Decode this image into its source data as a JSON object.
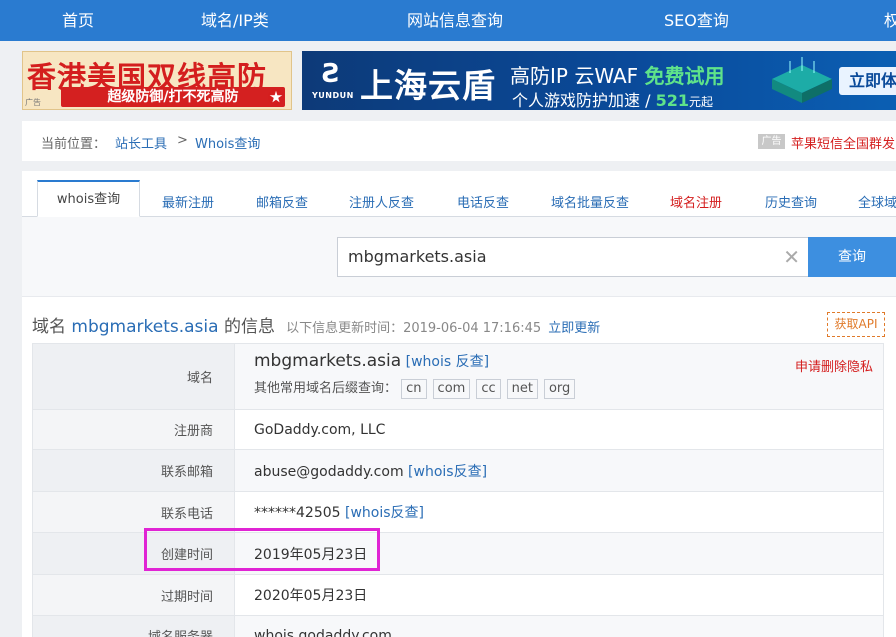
{
  "topnav": {
    "items": [
      "首页",
      "域名/IP类",
      "网站信息查询",
      "SEO查询",
      "权"
    ]
  },
  "ads": {
    "ad1": {
      "headline": "香港美国双线高防",
      "subline": "超级防御/打不死高防",
      "tag": "广告"
    },
    "ad2": {
      "brand": "YUNDUN",
      "big": "上海云盾",
      "line1_a": "高防IP 云WAF ",
      "line1_b": "免费试用",
      "line2_a": "个人游戏防护加速 / ",
      "line2_b": "521",
      "line2_c": "元起",
      "cta": "立即体"
    }
  },
  "breadcrumb": {
    "label": "当前位置：",
    "link1": "站长工具",
    "sep": ">",
    "link2": "Whois查询",
    "ad_tag": "广告",
    "ad_text": "苹果短信全国群发"
  },
  "tabs": [
    "whois查询",
    "最新注册",
    "邮箱反查",
    "注册人反查",
    "电话反查",
    "域名批量反查",
    "域名注册",
    "历史查询",
    "全球域"
  ],
  "search": {
    "value": "mbgmarkets.asia",
    "clear": "✕",
    "button": "查询"
  },
  "info_header": {
    "prefix": "域名 ",
    "domain": "mbgmarkets.asia",
    "suffix": " 的信息",
    "updated": "以下信息更新时间：2019-06-04 17:16:45",
    "update_now": "立即更新",
    "api": "获取API"
  },
  "table": {
    "domain_label": "域名",
    "domain_value": "mbgmarkets.asia",
    "domain_whois_link": "[whois 反查]",
    "suffix_label": "其他常用域名后缀查询：",
    "suffixes": [
      "cn",
      "com",
      "cc",
      "net",
      "org"
    ],
    "privacy": "申请删除隐私",
    "registrar_label": "注册商",
    "registrar_value": "GoDaddy.com, LLC",
    "email_label": "联系邮箱",
    "email_value": "abuse@godaddy.com",
    "email_link": "[whois反查]",
    "phone_label": "联系电话",
    "phone_value": "******42505",
    "phone_link": "[whois反查]",
    "created_label": "创建时间",
    "created_value": "2019年05月23日",
    "expire_label": "过期时间",
    "expire_value": "2020年05月23日",
    "ns_label": "域名服务器",
    "ns_value": "whois.godaddy.com"
  },
  "colors": {
    "nav": "#2a7bd0",
    "link": "#2a6db5",
    "highlight": "#e024d4",
    "red": "#d41e1e"
  }
}
